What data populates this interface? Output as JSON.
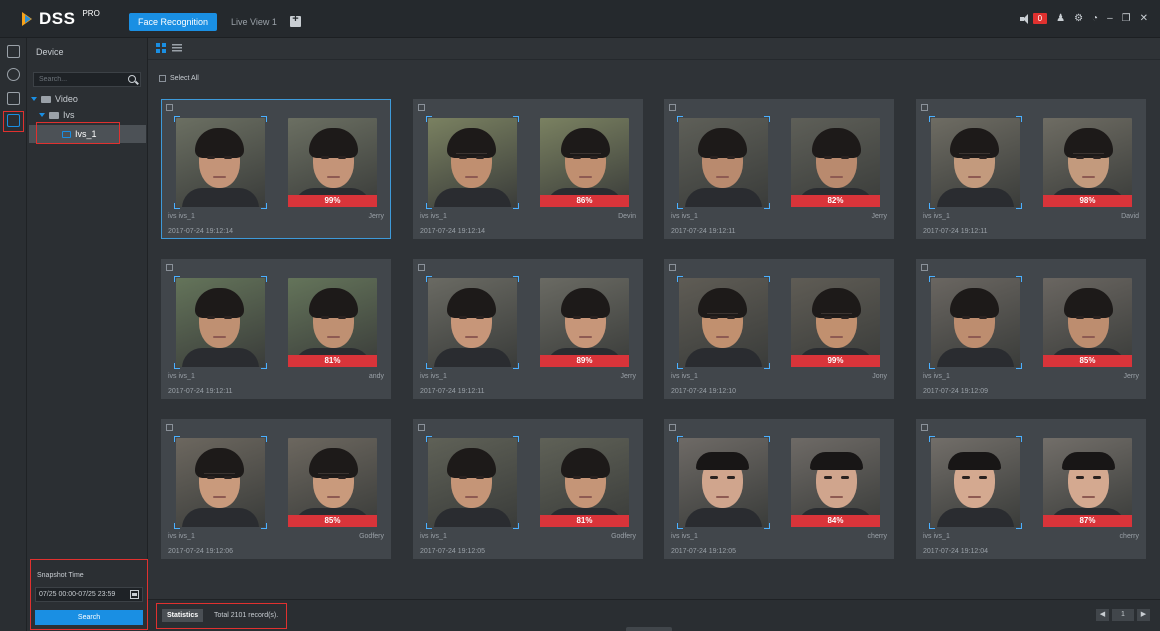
{
  "app": {
    "logo": "DSS",
    "logo_sup": "PRO"
  },
  "tabs": [
    {
      "label": "Face Recognition",
      "active": true
    },
    {
      "label": "Live View 1",
      "active": false
    }
  ],
  "titlebar": {
    "alarm_count": "0",
    "icons": [
      "speaker-icon",
      "user-icon",
      "settings-icon",
      "dashboard-icon",
      "minimize-icon",
      "restore-icon",
      "close-icon"
    ]
  },
  "device_panel": {
    "title": "Device",
    "search_placeholder": "Search...",
    "tree": [
      {
        "label": "Video",
        "level": 0
      },
      {
        "label": "Ivs",
        "level": 1
      },
      {
        "label": "Ivs_1",
        "level": 2,
        "selected": true
      }
    ]
  },
  "snapshot": {
    "label": "Snapshot Time",
    "value": "07/25 00:00-07/25 23:59",
    "search_label": "Search"
  },
  "main": {
    "select_all_label": "Select All",
    "cards": [
      {
        "source": "ivs  ivs_1",
        "name": "Jerry",
        "score": "99%",
        "time": "2017-07-24 19:12:14",
        "selected": true,
        "skin": "#c49478",
        "bg": "#6b6f62",
        "glasses": false,
        "female": false
      },
      {
        "source": "ivs  ivs_1",
        "name": "Devin",
        "score": "86%",
        "time": "2017-07-24 19:12:14",
        "selected": false,
        "skin": "#c08f70",
        "bg": "#7a8161",
        "glasses": true,
        "female": false
      },
      {
        "source": "ivs  ivs_1",
        "name": "Jerry",
        "score": "82%",
        "time": "2017-07-24 19:12:11",
        "selected": false,
        "skin": "#b98a6e",
        "bg": "#5e5f58",
        "glasses": false,
        "female": false
      },
      {
        "source": "ivs  ivs_1",
        "name": "David",
        "score": "98%",
        "time": "2017-07-24 19:12:11",
        "selected": false,
        "skin": "#c39a7d",
        "bg": "#6e6c63",
        "glasses": true,
        "female": false
      },
      {
        "source": "ivs  ivs_1",
        "name": "andy",
        "score": "81%",
        "time": "2017-07-24 19:12:11",
        "selected": false,
        "skin": "#bf9072",
        "bg": "#64745a",
        "glasses": false,
        "female": false
      },
      {
        "source": "ivs  ivs_1",
        "name": "Jerry",
        "score": "89%",
        "time": "2017-07-24 19:12:11",
        "selected": false,
        "skin": "#c79679",
        "bg": "#6a6a63",
        "glasses": false,
        "female": false
      },
      {
        "source": "ivs  ivs_1",
        "name": "Jony",
        "score": "99%",
        "time": "2017-07-24 19:12:10",
        "selected": false,
        "skin": "#c1906f",
        "bg": "#5f5c55",
        "glasses": true,
        "female": false
      },
      {
        "source": "ivs  ivs_1",
        "name": "Jerry",
        "score": "85%",
        "time": "2017-07-24 19:12:09",
        "selected": false,
        "skin": "#bd8d6f",
        "bg": "#6a6661",
        "glasses": false,
        "female": false
      },
      {
        "source": "ivs  ivs_1",
        "name": "Godfery",
        "score": "85%",
        "time": "2017-07-24 19:12:06",
        "selected": false,
        "skin": "#c99a7c",
        "bg": "#6c675f",
        "glasses": true,
        "female": false
      },
      {
        "source": "ivs  ivs_1",
        "name": "Godfery",
        "score": "81%",
        "time": "2017-07-24 19:12:05",
        "selected": false,
        "skin": "#c59577",
        "bg": "#5f6157",
        "glasses": false,
        "female": false
      },
      {
        "source": "ivs  ivs_1",
        "name": "cherry",
        "score": "84%",
        "time": "2017-07-24 19:12:05",
        "selected": false,
        "skin": "#d0a58d",
        "bg": "#6e6a66",
        "glasses": false,
        "female": true
      },
      {
        "source": "ivs  ivs_1",
        "name": "cherry",
        "score": "87%",
        "time": "2017-07-24 19:12:04",
        "selected": false,
        "skin": "#d4a990",
        "bg": "#726e69",
        "glasses": false,
        "female": true
      }
    ]
  },
  "statusbar": {
    "stats_label": "Statistics",
    "total_text": "Total  2101  record(s).",
    "page": "1"
  },
  "colors": {
    "accent": "#1a8fe3",
    "highlight": "#e0312f",
    "score_bar": "#d9343a"
  }
}
